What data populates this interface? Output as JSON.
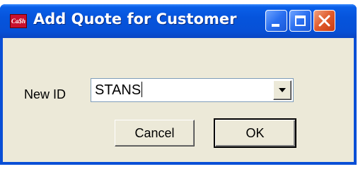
{
  "window": {
    "title": "Add Quote for Customer",
    "app_icon_text": "Ca$h"
  },
  "form": {
    "new_id_label": "New ID",
    "new_id_value": "STANS"
  },
  "buttons": {
    "cancel_label": "Cancel",
    "ok_label": "OK"
  },
  "colors": {
    "titlebar": "#0654dc",
    "client_bg": "#ece9d8",
    "close_button": "#e05a2a"
  }
}
